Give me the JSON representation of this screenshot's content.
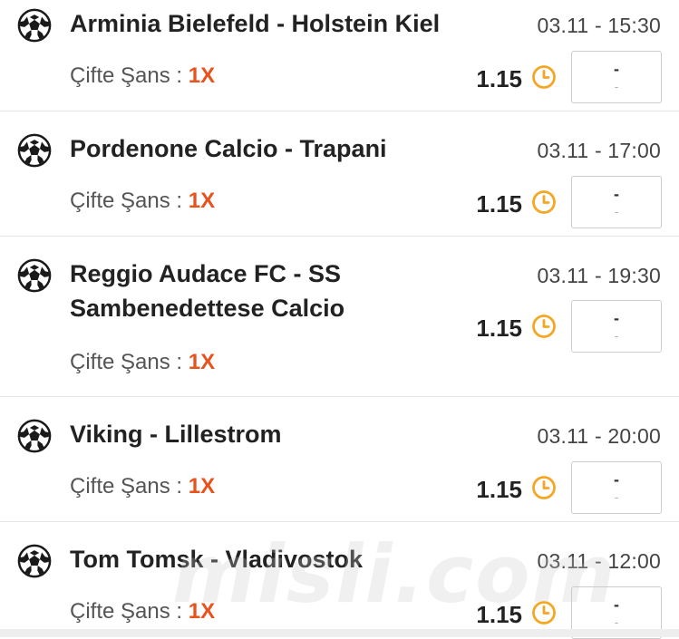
{
  "matches": [
    {
      "teams": "Arminia Bielefeld - Holstein Kiel",
      "datetime": "03.11 - 15:30",
      "bet_label": "Çifte Şans : ",
      "bet_pick": "1X",
      "odd": "1.15",
      "score_top": "-",
      "score_bottom": "-"
    },
    {
      "teams": "Pordenone Calcio - Trapani",
      "datetime": "03.11 - 17:00",
      "bet_label": "Çifte Şans : ",
      "bet_pick": "1X",
      "odd": "1.15",
      "score_top": "-",
      "score_bottom": "-"
    },
    {
      "teams_line1": "Reggio Audace FC - SS",
      "teams_line2": "Sambenedettese Calcio",
      "datetime": "03.11 - 19:30",
      "bet_label": "Çifte Şans : ",
      "bet_pick": "1X",
      "odd": "1.15",
      "score_top": "-",
      "score_bottom": "-"
    },
    {
      "teams": "Viking - Lillestrom",
      "datetime": "03.11 - 20:00",
      "bet_label": "Çifte Şans : ",
      "bet_pick": "1X",
      "odd": "1.15",
      "score_top": "-",
      "score_bottom": "-"
    },
    {
      "teams": "Tom Tomsk - Vladivostok",
      "datetime": "03.11 - 12:00",
      "bet_label": "Çifte Şans : ",
      "bet_pick": "1X",
      "odd": "1.15",
      "score_top": "-",
      "score_bottom": "-"
    }
  ],
  "watermark": "misli.com",
  "colors": {
    "pick": "#e8521c",
    "clock": "#f5a623",
    "divider": "#e4e4e4"
  },
  "icons": {
    "sport": "football-icon",
    "status": "clock-icon"
  }
}
